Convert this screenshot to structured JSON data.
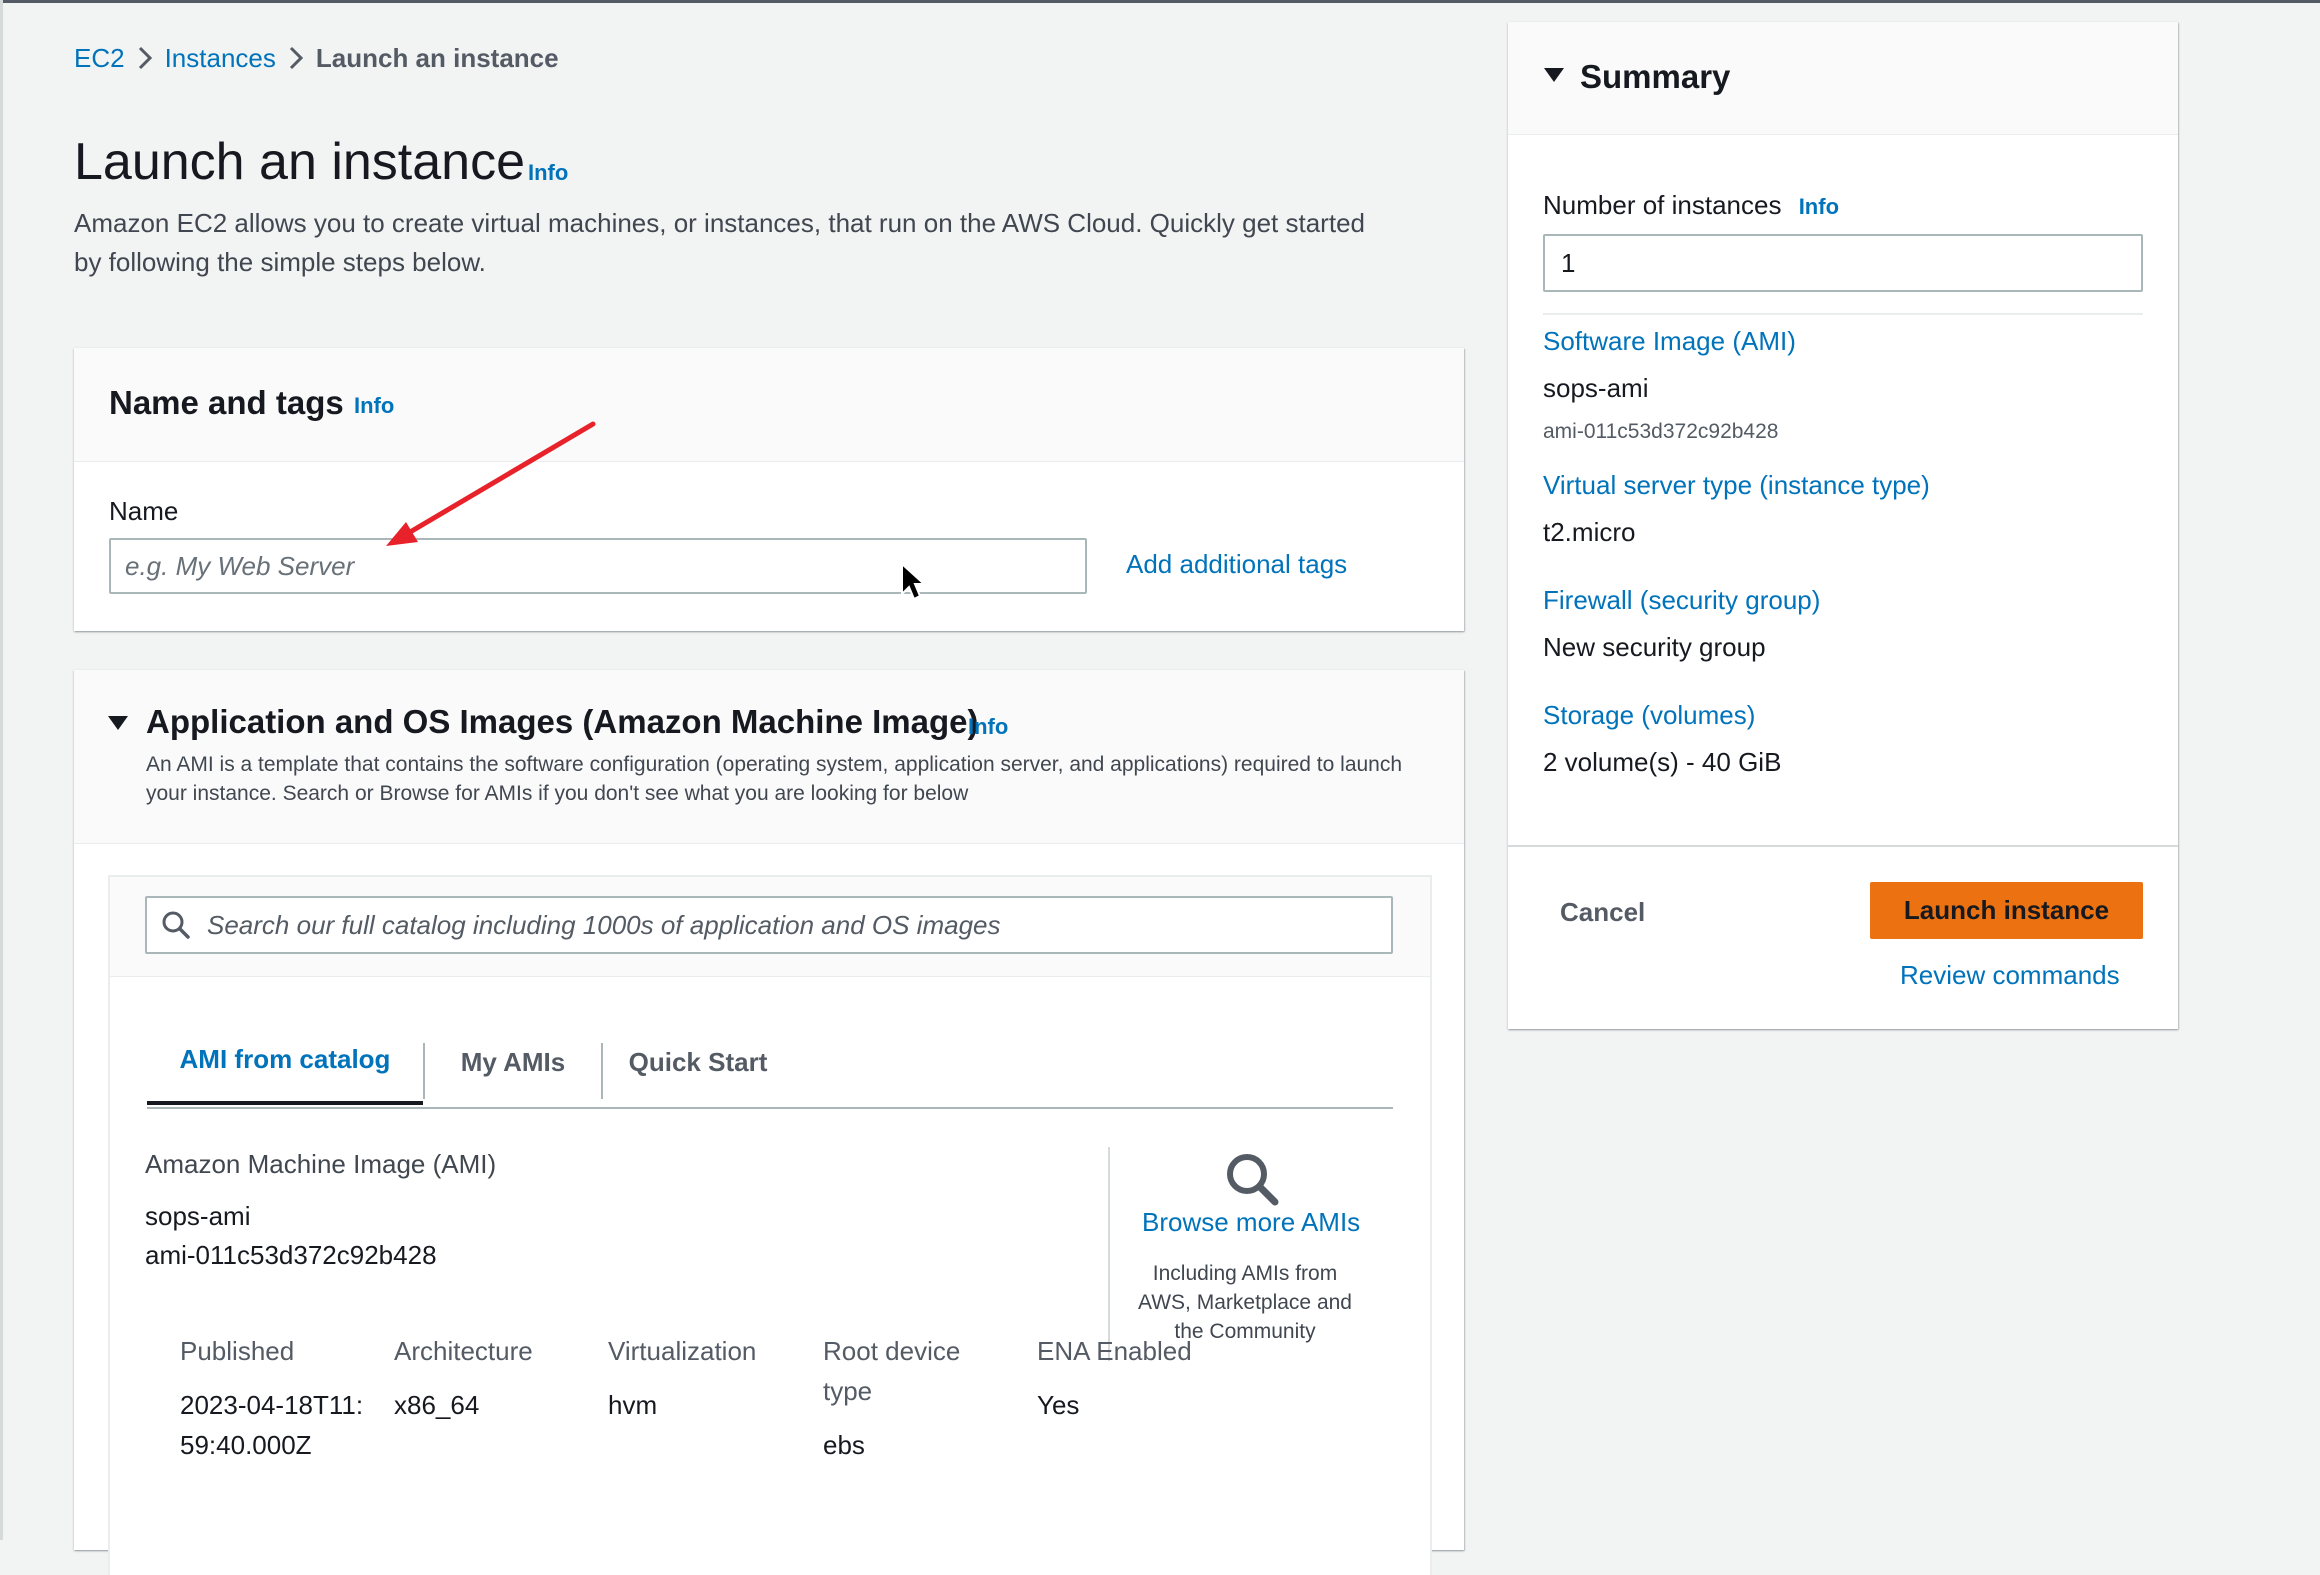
{
  "breadcrumb": {
    "items": [
      "EC2",
      "Instances"
    ],
    "current": "Launch an instance"
  },
  "page": {
    "title": "Launch an instance",
    "info": "Info",
    "description": "Amazon EC2 allows you to create virtual machines, or instances, that run on the AWS Cloud. Quickly get started by following the simple steps below."
  },
  "name_tags": {
    "title": "Name and tags",
    "info": "Info",
    "name_label": "Name",
    "name_placeholder": "e.g. My Web Server",
    "name_value": "",
    "add_tags": "Add additional tags"
  },
  "ami": {
    "title": "Application and OS Images (Amazon Machine Image)",
    "info": "Info",
    "description": "An AMI is a template that contains the software configuration (operating system, application server, and applications) required to launch your instance. Search or Browse for AMIs if you don't see what you are looking for below",
    "search_placeholder": "Search our full catalog including 1000s of application and OS images",
    "tabs": [
      {
        "label": "AMI from catalog",
        "active": true
      },
      {
        "label": "My AMIs",
        "active": false
      },
      {
        "label": "Quick Start",
        "active": false
      }
    ],
    "image_label": "Amazon Machine Image (AMI)",
    "image_name": "sops-ami",
    "image_id": "ami-011c53d372c92b428",
    "browse_link": "Browse more AMIs",
    "browse_note": "Including AMIs from AWS, Marketplace and the Community",
    "details": [
      {
        "header": "Published",
        "value": "2023-04-18T11:59:40.000Z"
      },
      {
        "header": "Architecture",
        "value": "x86_64"
      },
      {
        "header": "Virtualization",
        "value": "hvm"
      },
      {
        "header": "Root device type",
        "value": "ebs"
      },
      {
        "header": "ENA Enabled",
        "value": "Yes"
      }
    ]
  },
  "summary": {
    "title": "Summary",
    "instances_label": "Number of instances",
    "info": "Info",
    "instances_value": "1",
    "software_image_label": "Software Image (AMI)",
    "software_image_name": "sops-ami",
    "software_image_id": "ami-011c53d372c92b428",
    "instance_type_label": "Virtual server type (instance type)",
    "instance_type_value": "t2.micro",
    "firewall_label": "Firewall (security group)",
    "firewall_value": "New security group",
    "storage_label": "Storage (volumes)",
    "storage_value": "2 volume(s) - 40 GiB",
    "cancel": "Cancel",
    "launch": "Launch instance",
    "review": "Review commands"
  },
  "colors": {
    "link": "#0073bb",
    "primary_button": "#ec7211",
    "annotation_arrow": "#e8222a"
  }
}
